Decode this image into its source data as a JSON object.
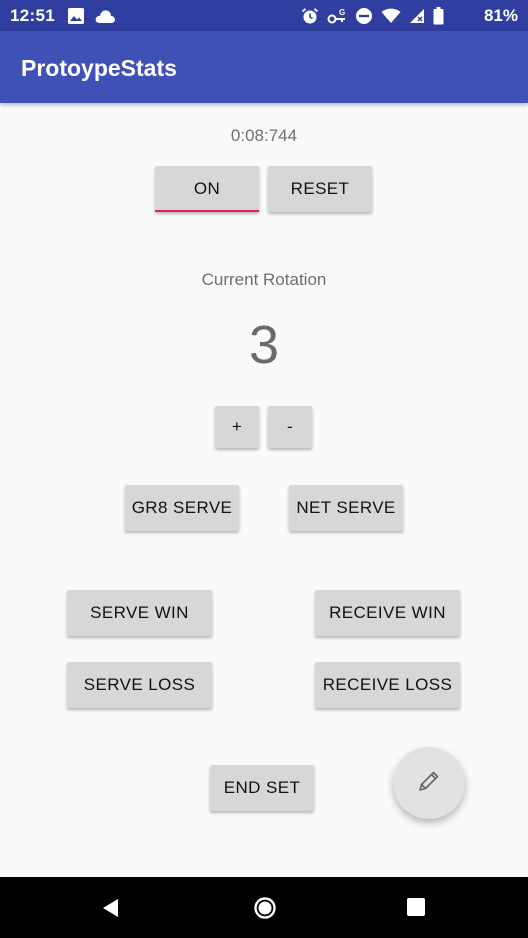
{
  "status_bar": {
    "time": "12:51",
    "battery": "81%",
    "left_icons": [
      "image-icon",
      "cloud-icon"
    ],
    "right_icons": [
      "alarm-icon",
      "vpn-key-icon",
      "do-not-disturb-icon",
      "wifi-icon",
      "signal-icon",
      "battery-icon"
    ]
  },
  "app_bar": {
    "title": "ProtoypeStats"
  },
  "timer": {
    "display": "0:08:744",
    "on_label": "ON",
    "reset_label": "RESET"
  },
  "rotation": {
    "label": "Current Rotation",
    "value": "3",
    "plus_label": "+",
    "minus_label": "-"
  },
  "serve_buttons": {
    "gr8_serve": "GR8 SERVE",
    "net_serve": "NET SERVE"
  },
  "result_buttons": {
    "serve_win": "SERVE WIN",
    "receive_win": "RECEIVE WIN",
    "serve_loss": "SERVE LOSS",
    "receive_loss": "RECEIVE LOSS"
  },
  "end_set_label": "END SET",
  "fab": {
    "icon": "pencil-icon"
  },
  "nav_bar": {
    "icons": [
      "back-icon",
      "home-icon",
      "recents-icon"
    ]
  },
  "colors": {
    "status_bar": "#303f9f",
    "app_bar": "#3f51b5",
    "accent": "#e91e63",
    "button": "#d6d7d7",
    "background": "#fafafa"
  }
}
